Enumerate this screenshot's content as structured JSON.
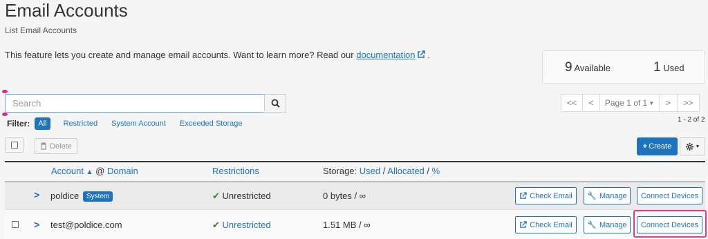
{
  "header": {
    "title": "Email Accounts",
    "subtitle": "List Email Accounts",
    "intro_text": "This feature lets you create and manage email accounts. Want to learn more? Read our ",
    "doc_link": "documentation",
    "intro_suffix": "."
  },
  "stats": {
    "available_count": "9",
    "available_label": "Available",
    "used_count": "1",
    "used_label": "Used"
  },
  "search": {
    "placeholder": "Search"
  },
  "pagination": {
    "first": "<<",
    "prev": "<",
    "page_label": "Page 1 of 1",
    "next": ">",
    "last": ">>",
    "count": "1 - 2 of 2"
  },
  "filter": {
    "label": "Filter:",
    "options": [
      "All",
      "Restricted",
      "System Account",
      "Exceeded Storage"
    ]
  },
  "toolbar": {
    "delete_label": "Delete",
    "create_label": "Create"
  },
  "table": {
    "col_account": "Account",
    "col_at": "@",
    "col_domain": "Domain",
    "col_restrictions": "Restrictions",
    "col_storage_prefix": "Storage:",
    "col_storage_used": "Used",
    "col_storage_sep1": "/",
    "col_storage_allocated": "Allocated",
    "col_storage_sep2": "/",
    "col_storage_pct": "%",
    "rows": [
      {
        "account": "poldice",
        "badge": "System",
        "restriction": "Unrestricted",
        "storage": "0 bytes / ∞",
        "check_email": "Check Email",
        "manage": "Manage",
        "connect": "Connect Devices"
      },
      {
        "account": "test@poldice.com",
        "restriction": "Unrestricted",
        "storage": "1.51 MB / ∞",
        "check_email": "Check Email",
        "manage": "Manage",
        "connect": "Connect Devices"
      }
    ]
  },
  "colors": {
    "accent": "#1e73be",
    "success": "#3c763d",
    "highlight": "#d6408b"
  }
}
